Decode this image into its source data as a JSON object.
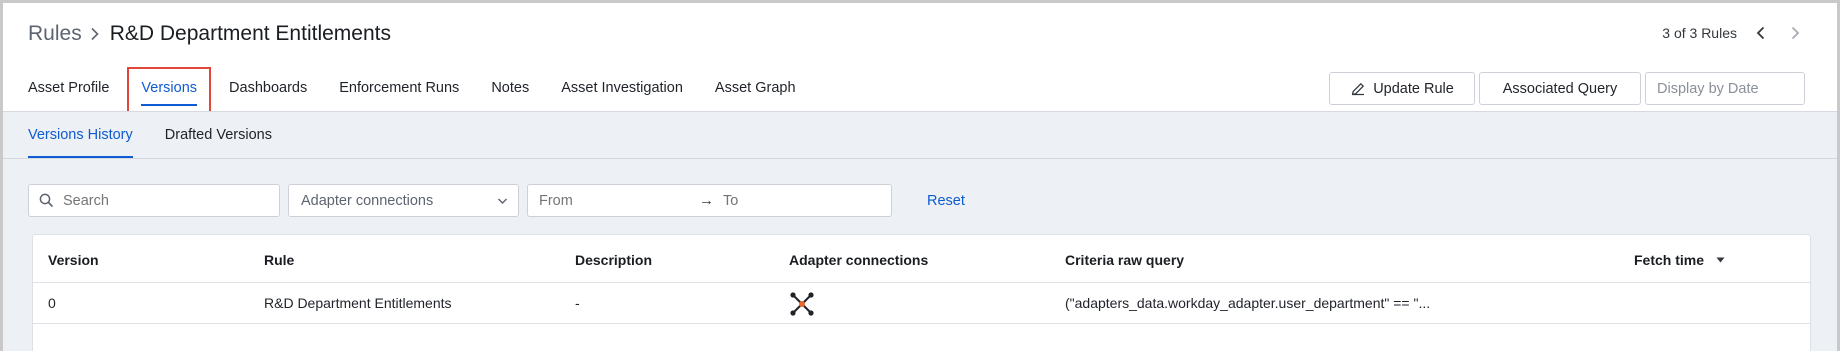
{
  "breadcrumb": {
    "parent": "Rules",
    "current": "R&D Department Entitlements"
  },
  "pager": {
    "text": "3 of 3 Rules"
  },
  "tabs": [
    {
      "label": "Asset Profile",
      "active": false
    },
    {
      "label": "Versions",
      "active": true
    },
    {
      "label": "Dashboards",
      "active": false
    },
    {
      "label": "Enforcement Runs",
      "active": false
    },
    {
      "label": "Notes",
      "active": false
    },
    {
      "label": "Asset Investigation",
      "active": false
    },
    {
      "label": "Asset Graph",
      "active": false
    }
  ],
  "actions": {
    "update_rule": "Update Rule",
    "associated_query": "Associated Query",
    "display_by_date_placeholder": "Display by Date"
  },
  "subtabs": [
    {
      "label": "Versions History",
      "active": true
    },
    {
      "label": "Drafted Versions",
      "active": false
    }
  ],
  "filters": {
    "search_placeholder": "Search",
    "adapter_select_value": "Adapter connections",
    "from_placeholder": "From",
    "range_arrow": "→",
    "to_placeholder": "To",
    "reset_label": "Reset"
  },
  "table": {
    "columns": [
      "Version",
      "Rule",
      "Description",
      "Adapter connections",
      "Criteria raw query",
      "Fetch time"
    ],
    "rows": [
      {
        "version": "0",
        "rule": "R&D Department Entitlements",
        "description": "-",
        "adapter_icon": "adapter-connections-icon",
        "criteria": "(\"adapters_data.workday_adapter.user_department\" == \"...",
        "fetch_time": ""
      }
    ]
  },
  "colors": {
    "accent": "#0f5bd1",
    "highlight_box": "#e0463a",
    "subarea_bg": "#edf0f4"
  }
}
